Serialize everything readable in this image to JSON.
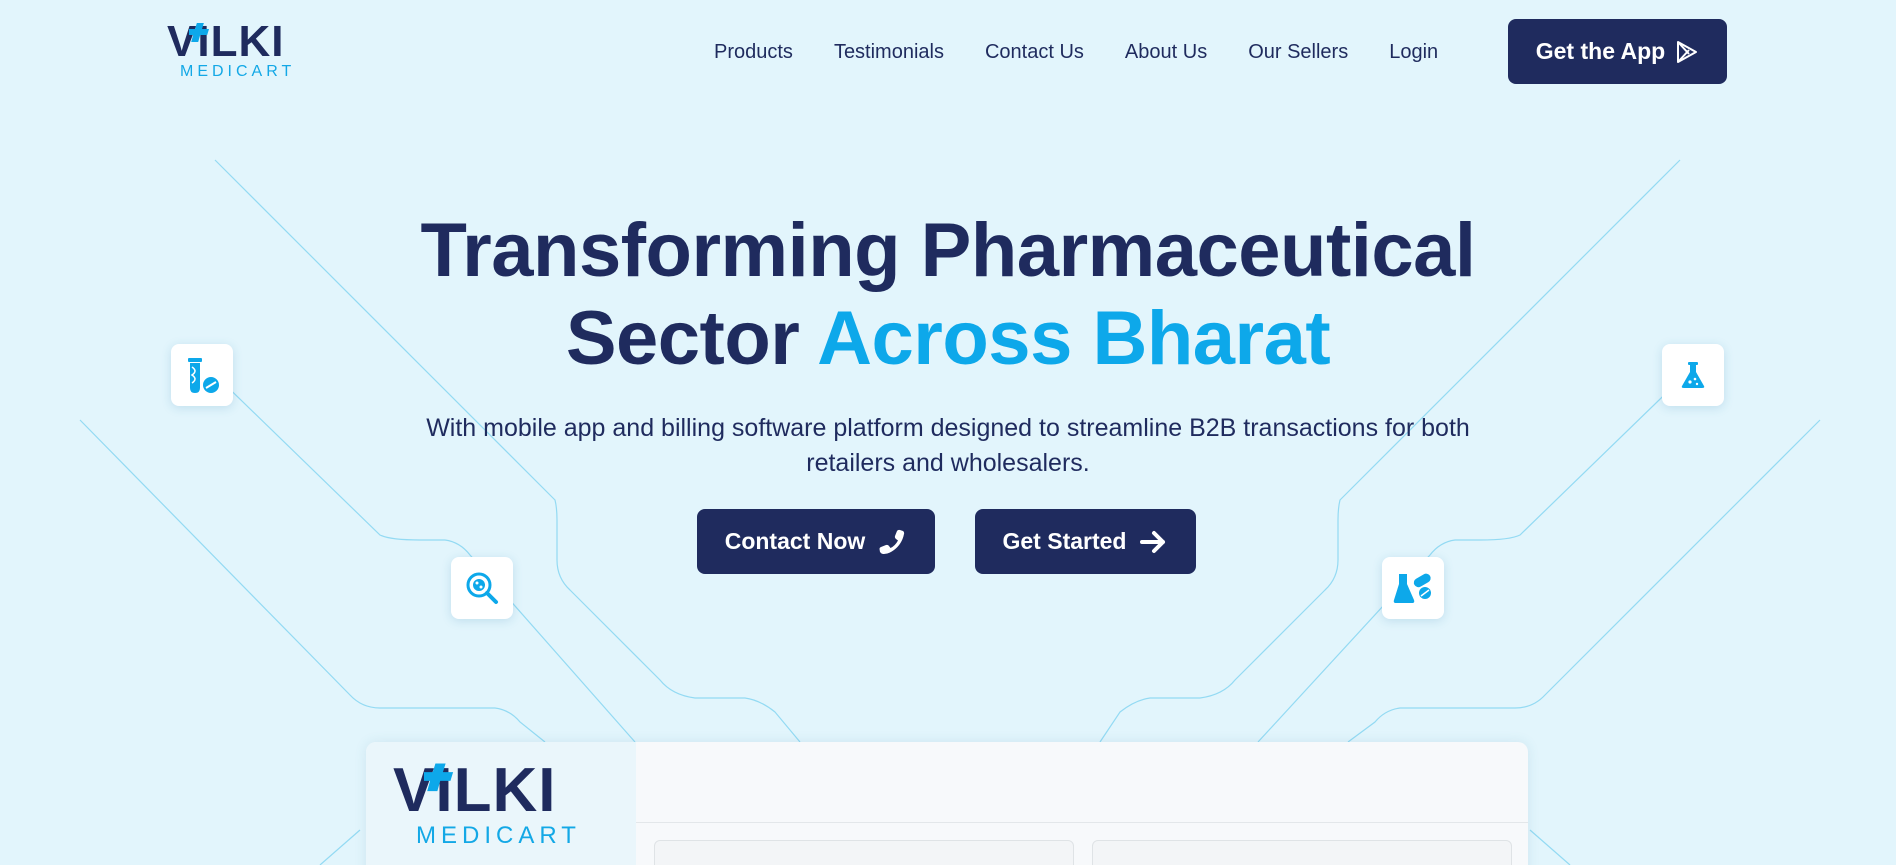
{
  "brand": {
    "name": "VILKI",
    "tagline": "MEDICART"
  },
  "nav": {
    "items": [
      "Products",
      "Testimonials",
      "Contact Us",
      "About Us",
      "Our Sellers",
      "Login"
    ],
    "cta": "Get the App"
  },
  "hero": {
    "title_line1": "Transforming Pharmaceutical",
    "title_line2_dark": "Sector ",
    "title_line2_accent": "Across Bharat",
    "subtitle": "With mobile app and billing software platform designed to streamline B2B transactions for both retailers and wholesalers.",
    "contact_button": "Contact Now",
    "start_button": "Get Started"
  },
  "floating_icons": [
    "test-tube-icon",
    "flask-icon",
    "magnifier-virus-icon",
    "flask-pills-icon"
  ],
  "preview": {
    "brand": "VILKI",
    "tagline": "MEDICART"
  },
  "colors": {
    "navy": "#1f2b5e",
    "accent": "#0da8ea",
    "background": "#e2f5fc"
  }
}
